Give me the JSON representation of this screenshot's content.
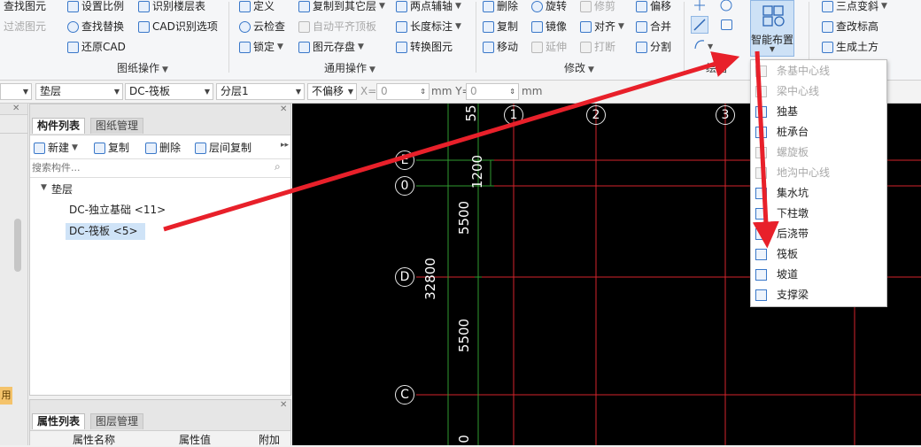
{
  "ribbon": {
    "drawing_ops": {
      "group_label": "图纸操作",
      "col1": [
        "查找图元",
        "过滤图元"
      ],
      "col2": [
        "设置比例",
        "查找替换",
        "还原CAD"
      ],
      "col3": [
        "识别楼层表",
        "CAD识别选项"
      ]
    },
    "general_ops": {
      "group_label": "通用操作",
      "col1": [
        "定义",
        "云检查",
        "锁定"
      ],
      "col2": [
        "复制到其它层",
        "自动平齐顶板",
        "图元存盘"
      ],
      "col3": [
        "两点辅轴",
        "长度标注",
        "转换图元"
      ]
    },
    "modify": {
      "group_label": "修改",
      "col1": [
        "删除",
        "复制",
        "移动"
      ],
      "col2": [
        "旋转",
        "镜像",
        "延伸"
      ],
      "col3": [
        "修剪",
        "对齐",
        "打断"
      ],
      "col4": [
        "偏移",
        "合并",
        "分割"
      ]
    },
    "draw": {
      "group_label": "绘图"
    },
    "smart_layout": {
      "label": "智能布置"
    },
    "right": [
      "三点变斜",
      "查改标高",
      "生成土方"
    ]
  },
  "toolbar": {
    "combo_layer": "垫层",
    "combo_component": "DC-筏板",
    "combo_sublayer": "分层1",
    "combo_offset": "不偏移",
    "x_label": "X=",
    "x_value": "0",
    "y_label": "mm Y=",
    "y_value": "0",
    "unit": "mm"
  },
  "component_panel": {
    "tabs": [
      "构件列表",
      "图纸管理"
    ],
    "buttons": {
      "new": "新建",
      "copy": "复制",
      "delete": "删除",
      "floor_copy": "层间复制"
    },
    "search_placeholder": "搜索构件...",
    "tree": {
      "root": "垫层",
      "items": [
        "DC-独立基础 <11>",
        "DC-筏板 <5>"
      ],
      "selected_index": 1
    }
  },
  "properties_panel": {
    "tabs": [
      "属性列表",
      "图层管理"
    ],
    "columns": [
      "属性名称",
      "属性值",
      "附加"
    ]
  },
  "left_edge_badge": "用",
  "canvas": {
    "axes": [
      "1",
      "2",
      "3",
      "E",
      "0",
      "D",
      "C"
    ],
    "dims": [
      "55",
      "1200",
      "5500",
      "32800",
      "5500",
      "0"
    ]
  },
  "smart_menu": {
    "items": [
      {
        "label": "条基中心线",
        "enabled": false,
        "icon": "strip-centerline-icon"
      },
      {
        "label": "梁中心线",
        "enabled": false,
        "icon": "beam-centerline-icon"
      },
      {
        "label": "独基",
        "enabled": true,
        "icon": "isolated-footing-icon"
      },
      {
        "label": "桩承台",
        "enabled": true,
        "icon": "pile-cap-icon"
      },
      {
        "label": "螺旋板",
        "enabled": false,
        "icon": "spiral-slab-icon"
      },
      {
        "label": "地沟中心线",
        "enabled": false,
        "icon": "trench-centerline-icon"
      },
      {
        "label": "集水坑",
        "enabled": true,
        "icon": "sump-pit-icon"
      },
      {
        "label": "下柱墩",
        "enabled": true,
        "icon": "column-pier-icon"
      },
      {
        "label": "后浇带",
        "enabled": true,
        "icon": "post-cast-strip-icon"
      },
      {
        "label": "筏板",
        "enabled": true,
        "icon": "raft-slab-icon"
      },
      {
        "label": "坡道",
        "enabled": true,
        "icon": "ramp-icon"
      },
      {
        "label": "支撑梁",
        "enabled": true,
        "icon": "support-beam-icon"
      }
    ]
  },
  "colors": {
    "canvas_bg": "#000000",
    "grid_red": "#d4232b",
    "grid_green": "#2f9a2f",
    "arrow_red": "#e8202a",
    "selection_bg": "#cfe3f7"
  }
}
